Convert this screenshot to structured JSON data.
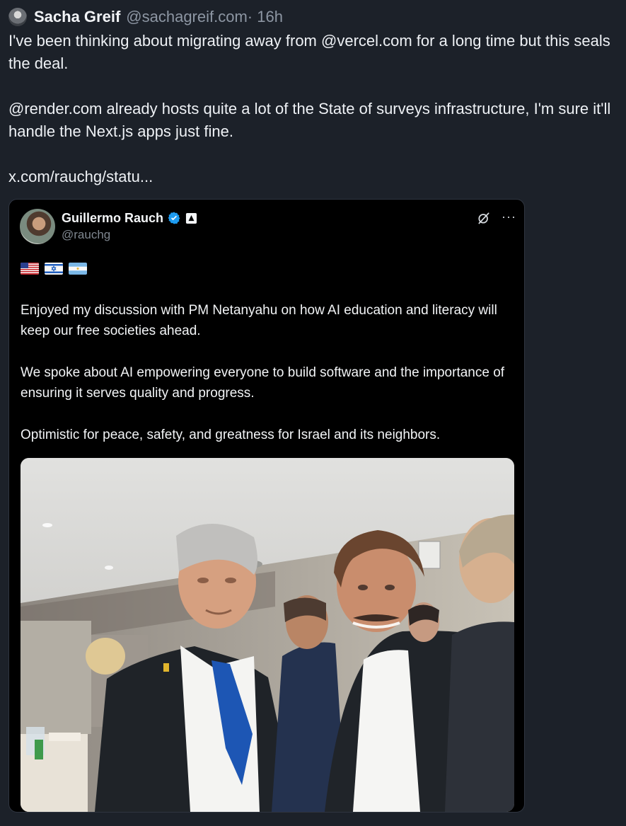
{
  "post": {
    "author_name": "Sacha Greif",
    "author_handle": "@sachagreif.com",
    "time": "· 16h",
    "text": [
      "I've been thinking about migrating away from @vercel.com for a long time but this seals the deal.",
      "@render.com already hosts quite a lot of the State of surveys infrastructure, I'm sure it'll handle the Next.js apps just fine.",
      "x.com/rauchg/statu..."
    ]
  },
  "embed": {
    "author_name": "Guillermo Rauch",
    "author_handle": "@rauchg",
    "flags": [
      "flag-us",
      "flag-israel",
      "flag-argentina"
    ],
    "text": [
      "Enjoyed my discussion with PM Netanyahu on how AI education and literacy will keep our free societies ahead.",
      "We spoke about AI empowering everyone to build software and the importance of ensuring it serves quality and progress.",
      "Optimistic for peace, safety, and greatness for Israel and its neighbors."
    ],
    "icons": {
      "verified": "verified-badge-icon",
      "affiliate": "affiliate-icon",
      "grok": "grok-icon",
      "more": "more-options-icon"
    }
  },
  "colors": {
    "background": "#1c2129",
    "card": "#000000",
    "muted_text": "#8d96a3",
    "verified_blue": "#1d9bf0"
  }
}
